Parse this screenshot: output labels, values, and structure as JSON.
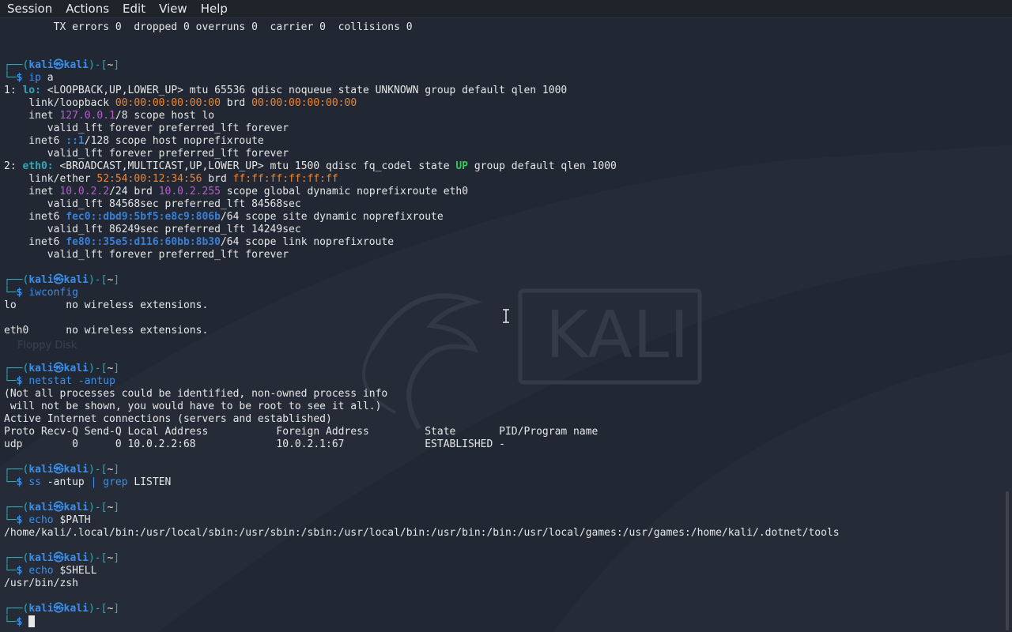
{
  "menubar": {
    "items": [
      "Session",
      "Actions",
      "Edit",
      "View",
      "Help"
    ]
  },
  "desktop": {
    "label": "Floppy Disk"
  },
  "wallpaper_logo": "KALI",
  "prompt": {
    "user": "kali",
    "host": "kali",
    "symbol": "㉿",
    "dir": "~",
    "dollar": "$"
  },
  "terminal": {
    "lines": [
      [
        {
          "t": "        TX errors 0  dropped 0 overruns 0  carrier 0  collisions 0"
        }
      ],
      [],
      [],
      {
        "prompt": true
      },
      {
        "cmd": [
          {
            "t": "ip",
            "c": "cmd"
          },
          {
            "t": " a"
          }
        ]
      },
      [
        {
          "t": "1: "
        },
        {
          "t": "lo:",
          "c": "teal-b"
        },
        {
          "t": " <LOOPBACK,UP,LOWER_UP> mtu 65536 qdisc noqueue state UNKNOWN group default qlen 1000"
        }
      ],
      [
        {
          "t": "    link/loopback "
        },
        {
          "t": "00:00:00:00:00:00",
          "c": "orange"
        },
        {
          "t": " brd "
        },
        {
          "t": "00:00:00:00:00:00",
          "c": "orange"
        }
      ],
      [
        {
          "t": "    inet "
        },
        {
          "t": "127.0.0.1",
          "c": "purple"
        },
        {
          "t": "/8 scope host lo"
        }
      ],
      [
        {
          "t": "       valid_lft forever preferred_lft forever"
        }
      ],
      [
        {
          "t": "    inet6 "
        },
        {
          "t": "::1",
          "c": "v6"
        },
        {
          "t": "/128 scope host noprefixroute"
        }
      ],
      [
        {
          "t": "       valid_lft forever preferred_lft forever"
        }
      ],
      [
        {
          "t": "2: "
        },
        {
          "t": "eth0:",
          "c": "teal-b"
        },
        {
          "t": " <BROADCAST,MULTICAST,UP,LOWER_UP> mtu 1500 qdisc fq_codel state "
        },
        {
          "t": "UP",
          "c": "green"
        },
        {
          "t": " group default qlen 1000"
        }
      ],
      [
        {
          "t": "    link/ether "
        },
        {
          "t": "52:54:00:12:34:56",
          "c": "orange"
        },
        {
          "t": " brd "
        },
        {
          "t": "ff:ff:ff:ff:ff:ff",
          "c": "orange"
        }
      ],
      [
        {
          "t": "    inet "
        },
        {
          "t": "10.0.2.2",
          "c": "purple"
        },
        {
          "t": "/24 brd "
        },
        {
          "t": "10.0.2.255",
          "c": "purple"
        },
        {
          "t": " scope global dynamic noprefixroute eth0"
        }
      ],
      [
        {
          "t": "       valid_lft 84568sec preferred_lft 84568sec"
        }
      ],
      [
        {
          "t": "    inet6 "
        },
        {
          "t": "fec0::dbd9:5bf5:e8c9:806b",
          "c": "v6"
        },
        {
          "t": "/64 scope site dynamic noprefixroute"
        }
      ],
      [
        {
          "t": "       valid_lft 86249sec preferred_lft 14249sec"
        }
      ],
      [
        {
          "t": "    inet6 "
        },
        {
          "t": "fe80::35e5:d116:60bb:8b30",
          "c": "v6"
        },
        {
          "t": "/64 scope link noprefixroute"
        }
      ],
      [
        {
          "t": "       valid_lft forever preferred_lft forever"
        }
      ],
      [],
      {
        "prompt": true
      },
      {
        "cmd": [
          {
            "t": "iwconfig",
            "c": "cmd"
          }
        ]
      },
      [
        {
          "t": "lo        no wireless extensions."
        }
      ],
      [],
      [
        {
          "t": "eth0      no wireless extensions."
        }
      ],
      [],
      [],
      {
        "prompt": true
      },
      {
        "cmd": [
          {
            "t": "netstat",
            "c": "cmd"
          },
          {
            "t": " -antup",
            "c": "cmd"
          }
        ]
      },
      [
        {
          "t": "(Not all processes could be identified, non-owned process info"
        }
      ],
      [
        {
          "t": " will not be shown, you would have to be root to see it all.)"
        }
      ],
      [
        {
          "t": "Active Internet connections (servers and established)"
        }
      ],
      [
        {
          "t": "Proto Recv-Q Send-Q Local Address           Foreign Address         State       PID/Program name"
        }
      ],
      [
        {
          "t": "udp        0      0 10.0.2.2:68             10.0.2.1:67             ESTABLISHED -"
        }
      ],
      [],
      {
        "prompt": true
      },
      {
        "cmd": [
          {
            "t": "ss",
            "c": "cmd"
          },
          {
            "t": " -antup "
          },
          {
            "t": "|",
            "c": "cmd"
          },
          {
            "t": " "
          },
          {
            "t": "grep",
            "c": "cmd"
          },
          {
            "t": " LISTEN"
          }
        ]
      },
      [],
      {
        "prompt": true
      },
      {
        "cmd": [
          {
            "t": "echo",
            "c": "cmd"
          },
          {
            "t": " $PATH"
          }
        ]
      },
      [
        {
          "t": "/home/kali/.local/bin:/usr/local/sbin:/usr/sbin:/sbin:/usr/local/bin:/usr/bin:/bin:/usr/local/games:/usr/games:/home/kali/.dotnet/tools"
        }
      ],
      [],
      {
        "prompt": true
      },
      {
        "cmd": [
          {
            "t": "echo",
            "c": "cmd"
          },
          {
            "t": " $SHELL"
          }
        ]
      },
      [
        {
          "t": "/usr/bin/zsh"
        }
      ],
      [],
      {
        "prompt": true
      },
      {
        "cmd": [],
        "cursor": true
      }
    ]
  }
}
